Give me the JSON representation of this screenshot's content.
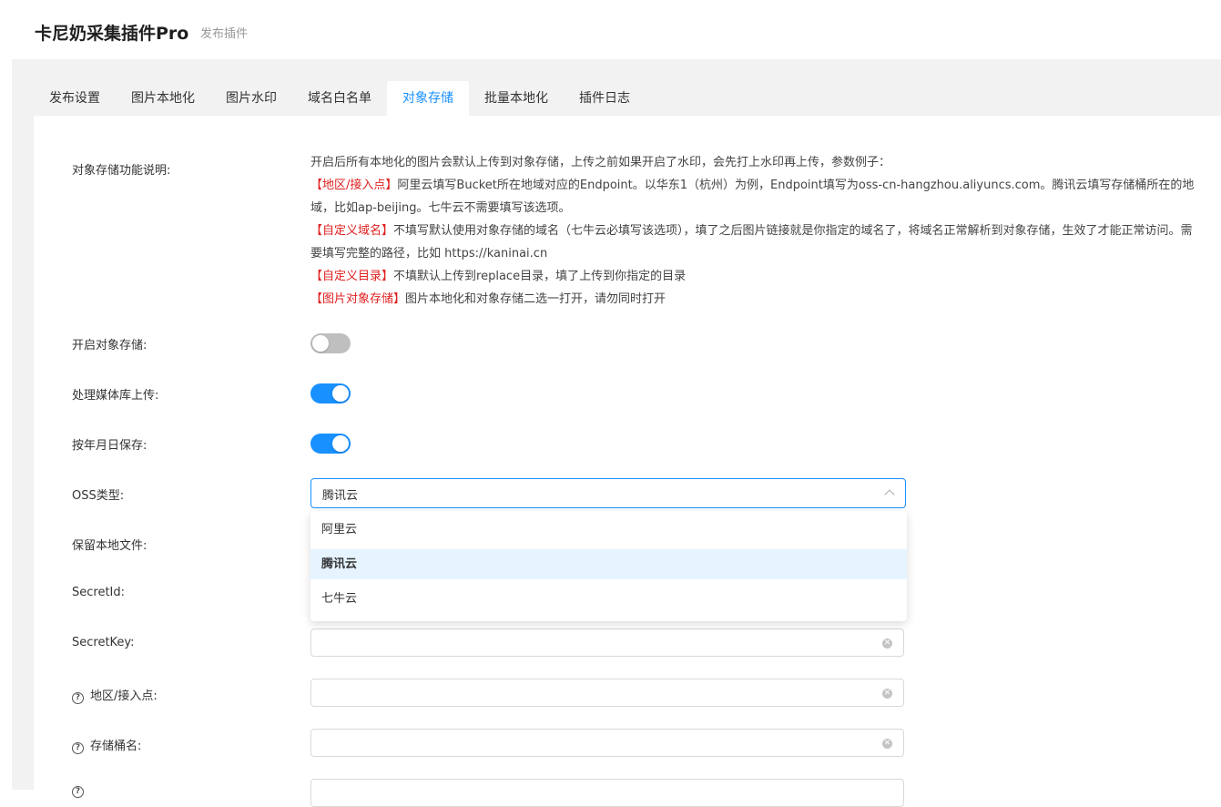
{
  "header": {
    "title": "卡尼奶采集插件Pro",
    "subtitle": "发布插件"
  },
  "tabs": [
    {
      "label": "发布设置",
      "active": false
    },
    {
      "label": "图片本地化",
      "active": false
    },
    {
      "label": "图片水印",
      "active": false
    },
    {
      "label": "域名白名单",
      "active": false
    },
    {
      "label": "对象存储",
      "active": true
    },
    {
      "label": "批量本地化",
      "active": false
    },
    {
      "label": "插件日志",
      "active": false
    }
  ],
  "form": {
    "description_label": "对象存储功能说明:",
    "description": {
      "line1": "开启后所有本地化的图片会默认上传到对象存储，上传之前如果开启了水印，会先打上水印再上传，参数例子：",
      "region_tag": "地区/接入点",
      "region_text": "阿里云填写Bucket所在地域对应的Endpoint。以华东1（杭州）为例，Endpoint填写为oss-cn-hangzhou.aliyuncs.com。腾讯云填写存储桶所在的地域，比如ap-beijing。七牛云不需要填写该选项。",
      "domain_tag": "自定义域名",
      "domain_text": "不填写默认使用对象存储的域名（七牛云必填写该选项），填了之后图片链接就是你指定的域名了，将域名正常解析到对象存储，生效了才能正常访问。需要填写完整的路径，比如 https://kaninai.cn",
      "dir_tag": "自定义目录",
      "dir_text": "不填默认上传到replace目录，填了上传到你指定的目录",
      "image_tag": "图片对象存储",
      "image_text": "图片本地化和对象存储二选一打开，请勿同时打开",
      "bracket_open": "【",
      "bracket_close": "】"
    },
    "enable_oss_label": "开启对象存储:",
    "enable_oss": false,
    "media_upload_label": "处理媒体库上传:",
    "media_upload": true,
    "date_save_label": "按年月日保存:",
    "date_save": true,
    "oss_type_label": "OSS类型:",
    "oss_type_value": "腾讯云",
    "oss_type_options": [
      "阿里云",
      "腾讯云",
      "七牛云"
    ],
    "keep_local_label": "保留本地文件:",
    "secret_id_label": "SecretId:",
    "secret_key_label": "SecretKey:",
    "secret_key_value": "",
    "region_label": "地区/接入点:",
    "region_value": "",
    "bucket_label": "存储桶名:",
    "bucket_value": ""
  },
  "colors": {
    "accent": "#1890ff",
    "highlight_red": "#e02020",
    "toggle_off": "#bfbfbf",
    "selected_option_bg": "#e6f4ff"
  },
  "icons": {
    "help": "question-circle-icon",
    "clear": "close-circle-icon",
    "select_arrow": "chevron-up-icon"
  }
}
